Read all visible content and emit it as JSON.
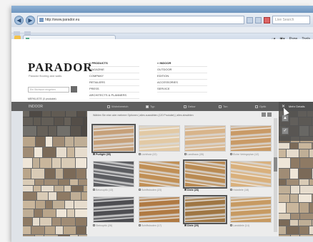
{
  "browser": {
    "url": "http://www.parador.eu",
    "search_placeholder": "Live Search",
    "back_icon": "back-arrow-icon",
    "forward_icon": "forward-arrow-icon",
    "tools": [
      "Page",
      "Tools"
    ]
  },
  "site": {
    "logo": "PARADOR",
    "tagline": "Parador flooring and walls",
    "search_placeholder": "Ein Stichwort eingeben",
    "my_list": "MERKLISTE (0 produkte)",
    "nav_col1": [
      {
        "label": "» PRODUCTS",
        "head": true
      },
      {
        "label": "MAGAZINE"
      },
      {
        "label": "COMPANY"
      },
      {
        "label": "RETAILERS"
      },
      {
        "label": "PRESS"
      },
      {
        "label": "ARCHITECTS & PLANNERS"
      }
    ],
    "nav_col2": [
      {
        "label": "» INDOOR",
        "head": true
      },
      {
        "label": "OUTDOOR"
      },
      {
        "label": "EDITION"
      },
      {
        "label": "ACCESSORIES"
      },
      {
        "label": "SERVICE"
      }
    ]
  },
  "filterbar": {
    "category": "INDOOR",
    "filters": [
      {
        "label": "Wohnbereich",
        "checked": false
      },
      {
        "label": "Typ",
        "checked": true
      },
      {
        "label": "Dekor",
        "checked": false
      },
      {
        "label": "Ton",
        "checked": false
      },
      {
        "label": "Optik",
        "checked": false
      }
    ]
  },
  "right_panel": {
    "title": "Mehr Details",
    "close_icon": "close-x-icon",
    "buttons": [
      "▲",
      "✓"
    ]
  },
  "grid": {
    "header": "Wählen Sie eine oder mehrere Optionen | alles auswählen (120 Produkte) | alles abwählen",
    "items": [
      {
        "label": "Purlight (35)",
        "selected": true,
        "color": "#c6a079"
      },
      {
        "label": "Lichtholz (22)",
        "selected": false,
        "color": "#e2c9a4"
      },
      {
        "label": "Landhaus (35)",
        "selected": false,
        "color": "#d8b48a"
      },
      {
        "label": "Eiche Verlegeplan (12)",
        "selected": false,
        "color": "#c99a66"
      },
      {
        "label": "Betonoptik (13)",
        "selected": false,
        "color": "#5b5c60"
      },
      {
        "label": "Schiffsboden (23)",
        "selected": false,
        "color": "#c08f55"
      },
      {
        "label": "Diele (28)",
        "selected": true,
        "color": "#b98a52"
      },
      {
        "label": "Holzdiele (18)",
        "selected": false,
        "color": "#d9b07c"
      },
      {
        "label": "Steinoptik (26)",
        "selected": false,
        "color": "#4e4e52"
      },
      {
        "label": "Schiffsboden (17)",
        "selected": false,
        "color": "#b07a43"
      },
      {
        "label": "Diele (29)",
        "selected": true,
        "color": "#9f7643"
      },
      {
        "label": "Landdiele (14)",
        "selected": false,
        "color": "#c79a62"
      }
    ]
  }
}
